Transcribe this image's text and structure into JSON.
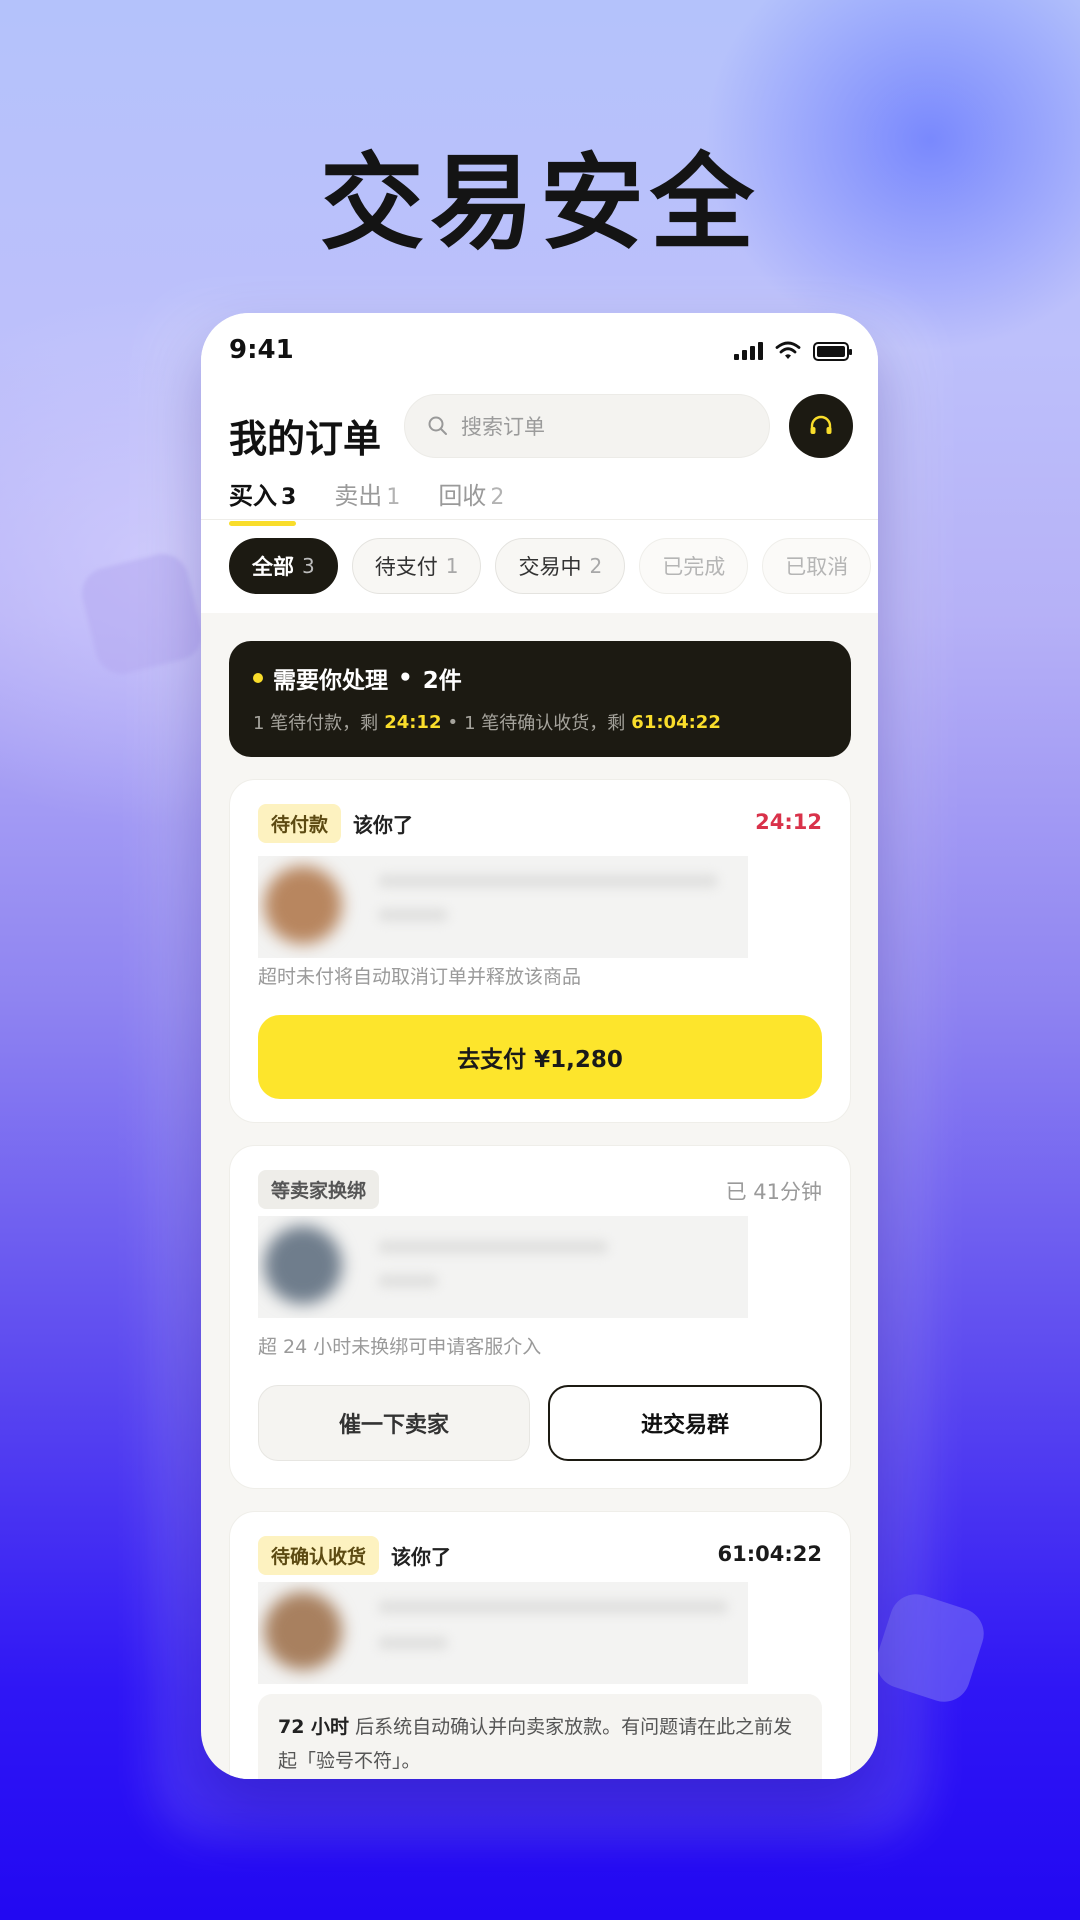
{
  "headline": "交易安全",
  "status_bar": {
    "time": "9:41"
  },
  "header": {
    "title": "我的订单",
    "search_placeholder": "搜索订单"
  },
  "tabs": [
    {
      "label": "买入",
      "count": "3",
      "active": true
    },
    {
      "label": "卖出",
      "count": "1",
      "active": false
    },
    {
      "label": "回收",
      "count": "2",
      "active": false
    }
  ],
  "chips": [
    {
      "label": "全部",
      "count": "3"
    },
    {
      "label": "待支付",
      "count": "1"
    },
    {
      "label": "交易中",
      "count": "2"
    },
    {
      "label": "已完成",
      "count": ""
    },
    {
      "label": "已取消",
      "count": ""
    }
  ],
  "notice": {
    "title": "需要你处理",
    "sep": "•",
    "count": "2件",
    "p1": "1 笔待付款，剩",
    "t1": "24:12",
    "dot": "•",
    "p2": "1 笔待确认收货，剩",
    "t2": "61:04:22"
  },
  "orders": [
    {
      "badge": "待付款",
      "turn": "该你了",
      "right": "24:12",
      "right_color": "#d9324a",
      "hint": "超时未付将自动取消订单并释放该商品",
      "pay_label": "去支付 ¥1,280"
    },
    {
      "badge": "等卖家换绑",
      "right": "已 41分钟",
      "hint": "超 24 小时未换绑可申请客服介入",
      "btn_left": "催一下卖家",
      "btn_right": "进交易群"
    },
    {
      "badge": "待确认收货",
      "turn": "该你了",
      "right": "61:04:22",
      "info_bold": "72 小时",
      "info_text": " 后系统自动确认并向卖家放款。有问题请在此之前发起「验号不符」。"
    }
  ],
  "colors": {
    "accent_yellow": "#fde52c",
    "dark": "#1c1a12",
    "countdown_red": "#d9324a"
  }
}
